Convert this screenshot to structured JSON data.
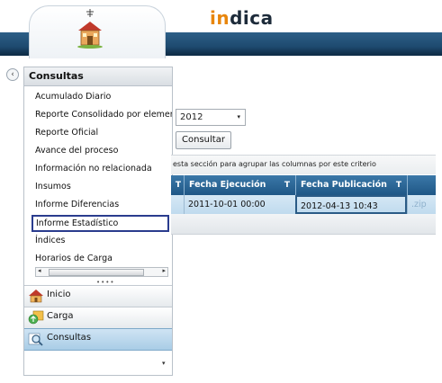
{
  "brand": {
    "part1": "in",
    "part2": "dica"
  },
  "sidebar": {
    "title": "Consultas",
    "items": [
      {
        "label": "Acumulado Diario"
      },
      {
        "label": "Reporte Consolidado por elemento"
      },
      {
        "label": "Reporte Oficial"
      },
      {
        "label": "Avance del proceso"
      },
      {
        "label": "Información no relacionada"
      },
      {
        "label": "Insumos"
      },
      {
        "label": "Informe Diferencias"
      },
      {
        "label": "Informe Estadístico",
        "active": true
      },
      {
        "label": "Índices"
      },
      {
        "label": "Horarios de Carga"
      }
    ],
    "scroll_left": "◂",
    "scroll_right": "▸",
    "grip": "••••",
    "nav": [
      {
        "label": "Inicio",
        "icon": "house-icon"
      },
      {
        "label": "Carga",
        "icon": "upload-icon"
      },
      {
        "label": "Consultas",
        "icon": "magnifier-icon",
        "active": true
      }
    ],
    "more_caret": "▾"
  },
  "collapse_glyph": "‹",
  "filters": {
    "year": "2012",
    "year_caret": "▾",
    "consultar_label": "Consultar"
  },
  "grid": {
    "group_hint": "esta sección para agrupar las columnas por este criterio",
    "filter_glyph": "T",
    "columns": [
      {
        "label": "Fecha Ejecución"
      },
      {
        "label": "Fecha Publicación"
      }
    ],
    "rows": [
      {
        "fecha_ejecucion": "2011-10-01 00:00",
        "fecha_publicacion": "2012-04-13 10:43",
        "extra": ".zip"
      }
    ]
  },
  "colors": {
    "accent": "#e8860c",
    "header_blue": "#1f5786",
    "selection": "#2a3c8e"
  }
}
